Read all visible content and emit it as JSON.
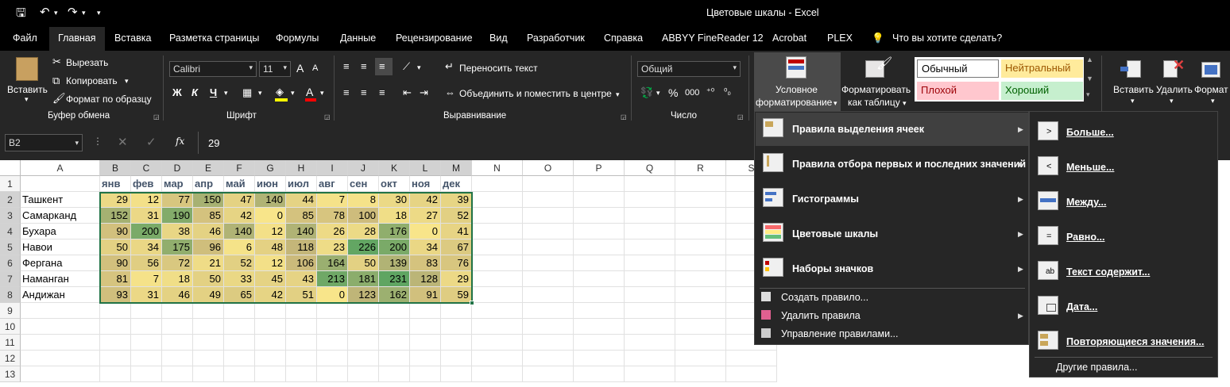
{
  "window": {
    "title": "Цветовые шкалы  -  Excel"
  },
  "tabs": [
    "Файл",
    "Главная",
    "Вставка",
    "Разметка страницы",
    "Формулы",
    "Данные",
    "Рецензирование",
    "Вид",
    "Разработчик",
    "Справка",
    "ABBYY FineReader 12",
    "Acrobat",
    "PLEX"
  ],
  "tell_me": "Что вы хотите сделать?",
  "clipboard": {
    "paste": "Вставить",
    "cut": "Вырезать",
    "copy": "Копировать",
    "format_painter": "Формат по образцу",
    "group": "Буфер обмена"
  },
  "font": {
    "name": "Calibri",
    "size": "11",
    "bold": "Ж",
    "italic": "К",
    "underline": "Ч",
    "grow": "A",
    "shrink": "A",
    "font_color": "A",
    "group": "Шрифт"
  },
  "alignment": {
    "wrap": "Переносить текст",
    "merge": "Объединить и поместить в центре",
    "group": "Выравнивание"
  },
  "number": {
    "format": "Общий",
    "percent": "%",
    "comma": "000",
    "group": "Число"
  },
  "styles": {
    "cf_line1": "Условное",
    "cf_line2": "форматирование",
    "fat_line1": "Форматировать",
    "fat_line2": "как таблицу",
    "normal": "Обычный",
    "neutral": "Нейтральный",
    "bad": "Плохой",
    "good": "Хороший"
  },
  "cells": {
    "insert": "Вставить",
    "delete": "Удалить",
    "format": "Формат"
  },
  "formula": {
    "namebox": "B2",
    "fx": "fx",
    "value": "29"
  },
  "columns": [
    "A",
    "B",
    "C",
    "D",
    "E",
    "F",
    "G",
    "H",
    "I",
    "J",
    "K",
    "L",
    "M",
    "N",
    "O",
    "P",
    "Q",
    "R",
    "S"
  ],
  "rows": [
    "1",
    "2",
    "3",
    "4",
    "5",
    "6",
    "7",
    "8",
    "9",
    "10",
    "11",
    "12",
    "13"
  ],
  "months": [
    "янв",
    "фев",
    "мар",
    "апр",
    "май",
    "июн",
    "июл",
    "авг",
    "сен",
    "окт",
    "ноя",
    "дек"
  ],
  "table": [
    {
      "city": "Ташкент",
      "values": [
        29,
        12,
        77,
        150,
        47,
        140,
        44,
        7,
        8,
        30,
        42,
        39
      ]
    },
    {
      "city": "Самарканд",
      "values": [
        152,
        31,
        190,
        85,
        42,
        0,
        85,
        78,
        100,
        18,
        27,
        52
      ]
    },
    {
      "city": "Бухара",
      "values": [
        90,
        200,
        38,
        46,
        140,
        12,
        140,
        26,
        28,
        176,
        0,
        41
      ]
    },
    {
      "city": "Навои",
      "values": [
        50,
        34,
        175,
        96,
        6,
        48,
        118,
        23,
        226,
        200,
        34,
        67
      ]
    },
    {
      "city": "Фергана",
      "values": [
        90,
        56,
        72,
        21,
        52,
        12,
        106,
        164,
        50,
        139,
        83,
        76
      ]
    },
    {
      "city": "Наманган",
      "values": [
        81,
        7,
        18,
        50,
        33,
        45,
        43,
        213,
        181,
        231,
        128,
        29
      ]
    },
    {
      "city": "Андижан",
      "values": [
        93,
        31,
        46,
        49,
        65,
        42,
        51,
        0,
        123,
        162,
        91,
        59
      ]
    }
  ],
  "colors": {
    "accent": "#217346",
    "scale_low": "#f8e58a",
    "scale_mid": "#c8b77a",
    "scale_high": "#63a663",
    "selection_border": "#217346"
  },
  "menu": {
    "items": [
      "Правила выделения ячеек",
      "Правила отбора первых и последних значений",
      "Гистограммы",
      "Цветовые шкалы",
      "Наборы значков"
    ],
    "actions": [
      "Создать правило...",
      "Удалить правила",
      "Управление правилами..."
    ]
  },
  "submenu": {
    "items": [
      "Больше...",
      "Меньше...",
      "Между...",
      "Равно...",
      "Текст содержит...",
      "Дата...",
      "Повторяющиеся значения..."
    ],
    "other": "Другие правила..."
  }
}
